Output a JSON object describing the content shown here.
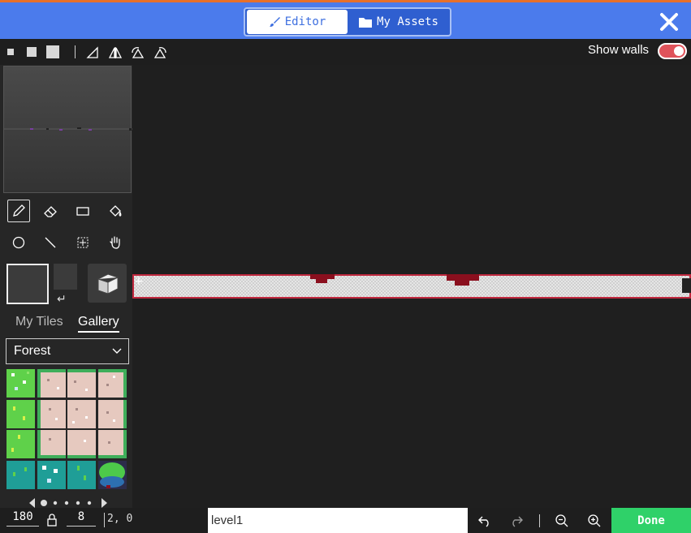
{
  "header": {
    "tabs": [
      {
        "label": "Editor",
        "icon": "paintbrush-icon",
        "active": true
      },
      {
        "label": "My Assets",
        "icon": "folder-icon",
        "active": false
      }
    ],
    "close_icon": "close-icon",
    "bar_color": "#4b7bec",
    "accent_border": "#e8702a"
  },
  "toolbar": {
    "brush_sizes": [
      "small-square-icon",
      "medium-square-icon",
      "large-square-icon"
    ],
    "mirror_tools": [
      "flip-horizontal-icon",
      "flip-vertical-icon",
      "rotate-ccw-icon",
      "rotate-cw-icon"
    ],
    "show_walls_label": "Show walls",
    "show_walls_on": true
  },
  "tools": [
    {
      "name": "pencil-icon",
      "active": true
    },
    {
      "name": "eraser-icon",
      "active": false
    },
    {
      "name": "rectangle-icon",
      "active": false
    },
    {
      "name": "fill-bucket-icon",
      "active": false
    },
    {
      "name": "circle-icon",
      "active": false
    },
    {
      "name": "line-icon",
      "active": false
    },
    {
      "name": "marquee-icon",
      "active": false
    },
    {
      "name": "pan-hand-icon",
      "active": false
    }
  ],
  "gallery": {
    "tabs": [
      "My Tiles",
      "Gallery"
    ],
    "active_tab": "Gallery",
    "selected_set": "Forest"
  },
  "bottom": {
    "width": "180",
    "height": "8",
    "lock_icon": "lock-icon",
    "coords": "2, 0",
    "level_name": "level1",
    "done_label": "Done",
    "done_color": "#2fd169"
  }
}
